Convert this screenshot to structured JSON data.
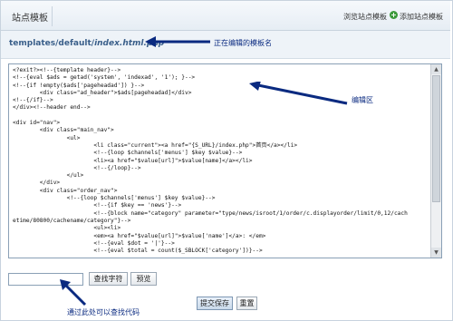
{
  "header": {
    "title": "站点模板",
    "browse_label": "浏览站点模板",
    "add_label": "添加站点模板"
  },
  "path": {
    "prefix": "templates/default/",
    "file": "index.html.php"
  },
  "annotations": {
    "editing_template_name": "正在编辑的模板名",
    "editor_area": "编辑区",
    "search_hint": "通过此处可以查找代码"
  },
  "editor": {
    "lines": [
      "<?exit?><!--{template header}-->",
      "<!--{eval $ads = getad('system', 'indexad', '1'); }-->",
      "<!--{if !empty($ads['pageheadad']) }-->",
      "        <div class=\"ad_header\">$ads[pageheadad]</div>",
      "<!--{/if}-->",
      "</div><!--header end-->",
      "",
      "<div id=\"nav\">",
      "        <div class=\"main_nav\">",
      "                <ul>",
      "                        <li class=\"current\"><a href=\"{S_URL}/index.php\">首页</a></li>",
      "                        <!--{loop $channels['menus'] $key $value}-->",
      "                        <li><a href=\"$value[url]\">$value[name]</a></li>",
      "                        <!--{/loop}-->",
      "                </ul>",
      "        </div>",
      "        <div class=\"order_nav\">",
      "                <!--{loop $channels['menus'] $key $value}-->",
      "                        <!--{if $key == 'news'}-->",
      "                        <!--{block name=\"category\" parameter=\"type/news/isroot/1/order/c.displayorder/limit/0,12/cach",
      "etime/80800/cachename/category\"}-->",
      "                        <ul><li>",
      "                        <em><a href=\"$value[url]\">$value['name']</a>: </em>",
      "                        <!--{eval $dot = '|'}-->",
      "                        <!--{eval $total = count($_SBLOCK['category'])}-->"
    ]
  },
  "search": {
    "value": "",
    "find_label": "查找字符",
    "preview_label": "预览"
  },
  "form": {
    "submit_label": "提交保存",
    "reset_label": "重置"
  }
}
